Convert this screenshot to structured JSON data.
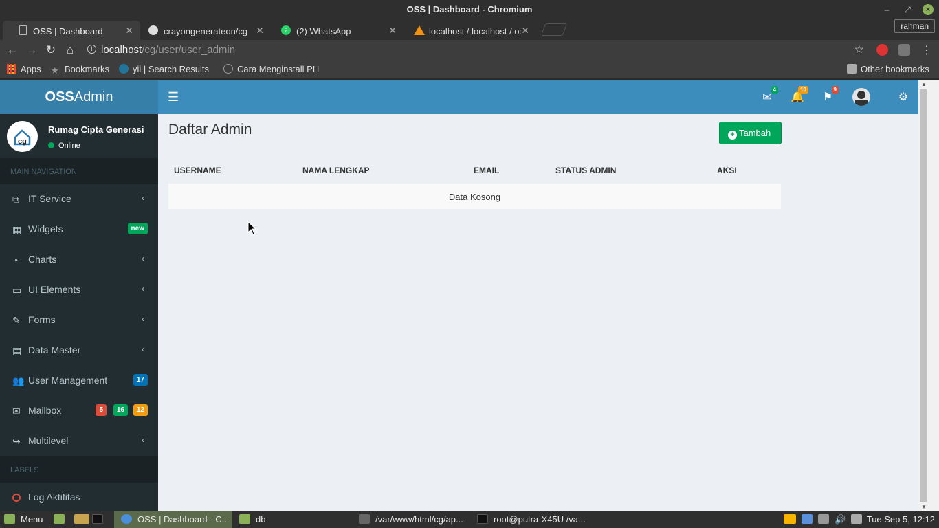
{
  "window": {
    "title": "OSS | Dashboard - Chromium"
  },
  "tabs": [
    {
      "label": "OSS | Dashboard",
      "active": true
    },
    {
      "label": "crayongenerateon/cg"
    },
    {
      "label": "(2) WhatsApp",
      "badge": "2"
    },
    {
      "label": "localhost / localhost / o:"
    }
  ],
  "profile": "rahman",
  "address": {
    "host": "localhost",
    "path": "/cg/user/user_admin"
  },
  "bookmarks": [
    {
      "label": "Apps"
    },
    {
      "label": "Bookmarks"
    },
    {
      "label": "yii | Search Results"
    },
    {
      "label": "Cara Menginstall PH"
    },
    {
      "label": "Other bookmarks"
    }
  ],
  "app": {
    "logo_bold": "OSS",
    "logo_rest": "Admin",
    "nav_badges": {
      "mail": "4",
      "notif": "10",
      "flag": "9"
    },
    "colors": {
      "primary": "#3c8dbc",
      "sidebar": "#222d32",
      "success": "#00a65a"
    }
  },
  "sidebar": {
    "user_name": "Rumag Cipta Generasi",
    "user_status": "Online",
    "main_header": "MAIN NAVIGATION",
    "items": [
      {
        "label": "IT Service",
        "icon": "edit-docs-icon"
      },
      {
        "label": "Widgets",
        "icon": "grid-icon",
        "pill": "new"
      },
      {
        "label": "Charts",
        "icon": "pie-chart-icon"
      },
      {
        "label": "UI Elements",
        "icon": "laptop-icon"
      },
      {
        "label": "Forms",
        "icon": "edit-icon"
      },
      {
        "label": "Data Master",
        "icon": "table-icon"
      },
      {
        "label": "User Management",
        "icon": "users-icon",
        "pill": "17"
      },
      {
        "label": "Mailbox",
        "icon": "envelope-icon",
        "pills": [
          "5",
          "16",
          "12"
        ]
      },
      {
        "label": "Multilevel",
        "icon": "share-icon"
      }
    ],
    "labels_header": "LABELS",
    "label_items": [
      {
        "label": "Log Aktifitas",
        "icon": "circle-icon"
      }
    ]
  },
  "content": {
    "title": "Daftar Admin",
    "add_button": "Tambah",
    "columns": [
      "USERNAME",
      "NAMA LENGKAP",
      "EMAIL",
      "STATUS ADMIN",
      "AKSI"
    ],
    "empty_text": "Data Kosong"
  },
  "taskbar": {
    "menu": "Menu",
    "windows": [
      {
        "label": "OSS | Dashboard - C..."
      },
      {
        "label": "db"
      },
      {
        "label": "/var/www/html/cg/ap..."
      },
      {
        "label": "root@putra-X45U /va..."
      }
    ],
    "clock": "Tue Sep  5, 12:12"
  }
}
